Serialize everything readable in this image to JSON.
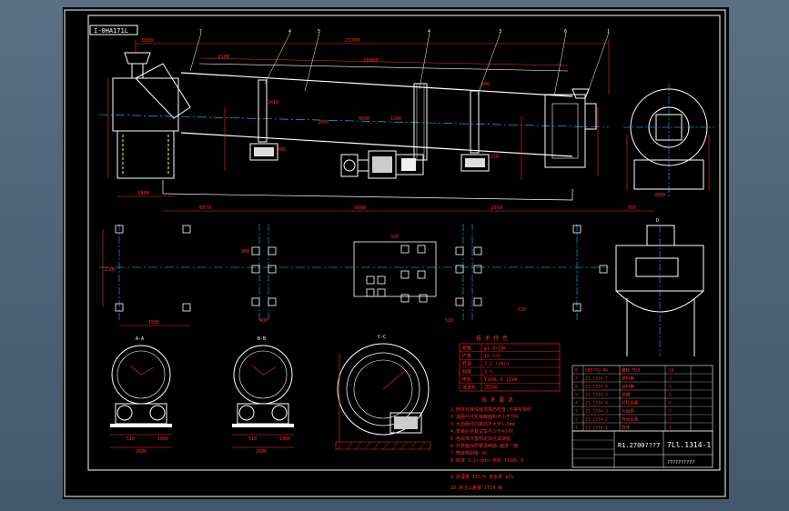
{
  "colors": {
    "background": "#4d6175",
    "sheet": "#000000",
    "border": "#ffffff",
    "outline": "#ffffff",
    "dimension": "#ff2a2a",
    "center_line": "#00e5ff",
    "hidden_line": "#ffff33",
    "block": "#e8e8e8",
    "yellow": "#ffd400"
  },
  "title_tag": "I-0HA171L",
  "drawing_no": "7Ll.1314-1",
  "table_title_code": "R1.2700???7",
  "drawing_no_small": "??????????",
  "section_labels": {
    "a": "A-A",
    "b": "B-B",
    "c": "C-C",
    "d": "D"
  },
  "balloons": [
    "7",
    "4",
    "5",
    "4",
    "3",
    "6",
    "1"
  ],
  "dims": {
    "d1": "1600",
    "d2": "23700",
    "d3": "18000",
    "d4": "2100",
    "d5": "6070",
    "d6": "2950",
    "d7": "1410",
    "d8": "5000",
    "d9": "1450",
    "d10": "700",
    "d11": "4500",
    "d12": "1500",
    "d13": "600",
    "d14": "1800",
    "d15": "250",
    "d16": "400",
    "d17": "2600",
    "d18": "510",
    "d19": "1060",
    "d20": "3000",
    "d21": "1200",
    "d22": "900",
    "d23": "320",
    "d24": "630"
  },
  "note_title": "技 术 要 求",
  "notes": [
    "1.筒体对接焊缝须探伤检查,不得有裂纹",
    "2.滚圈与托轮接触面积不小于70%",
    "3.大齿圈径向跳动不大于1.5mm",
    "4.安装后空载试车不少于4小时",
    "5.各润滑点按规定加注润滑脂",
    "6.外表面涂防锈漆两遍,面漆一遍",
    "7.筒体倾斜度 3%",
    "8.转速 3.2r/min 电机 Y160L-6",
    "9.处理量 15t/h 含水率 ≤1%",
    "10.未注公差按 IT14 级"
  ],
  "spec_title": "技 术 特 性",
  "spec_rows": [
    [
      "规格",
      "φ1.8×18m"
    ],
    [
      "产量",
      "15 t/h"
    ],
    [
      "转速",
      "3.2 r/min"
    ],
    [
      "斜度",
      "3 %"
    ],
    [
      "电机",
      "Y160L-6 11kW"
    ],
    [
      "减速机",
      "ZQ500"
    ]
  ],
  "parts_rows": [
    [
      "8",
      "GB5782-86",
      "螺栓 M20",
      "16"
    ],
    [
      "7",
      "Z1.1314-7",
      "进料箱",
      "1"
    ],
    [
      "6",
      "Z1.1314-6",
      "出料箱",
      "1"
    ],
    [
      "5",
      "Z1.1314-5",
      "滚圈",
      "2"
    ],
    [
      "4",
      "Z1.1314-4",
      "托轮装置",
      "4"
    ],
    [
      "3",
      "Z1.1314-3",
      "大齿圈",
      "1"
    ],
    [
      "2",
      "Z1.1314-2",
      "传动装置",
      "1"
    ],
    [
      "1",
      "Z1.1314-1",
      "筒体",
      "1"
    ]
  ]
}
